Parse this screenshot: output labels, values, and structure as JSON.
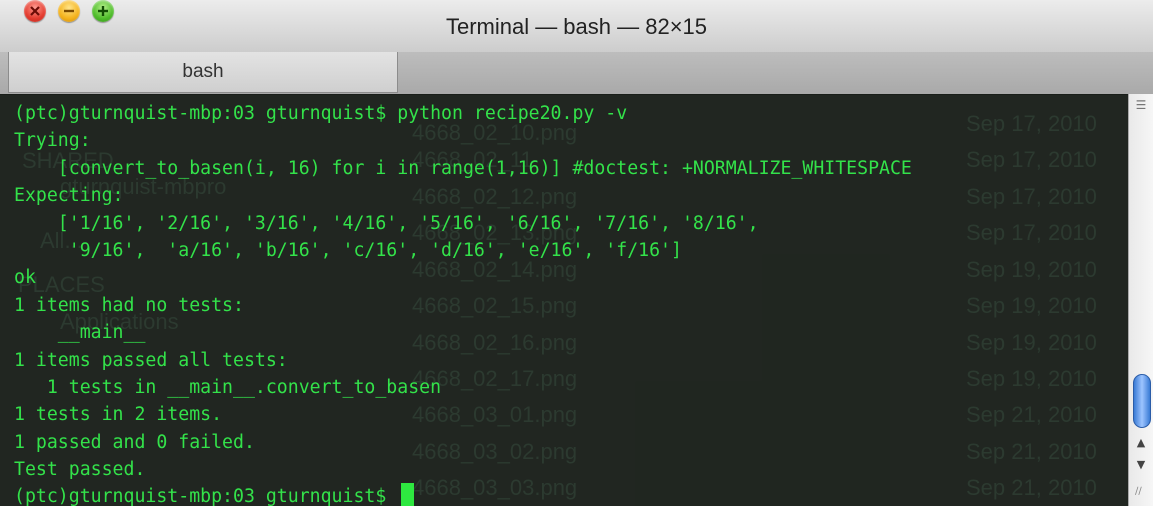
{
  "window": {
    "title": "Terminal — bash — 82×15",
    "tab_label": "bash"
  },
  "terminal": {
    "lines": [
      "(ptc)gturnquist-mbp:03 gturnquist$ python recipe20.py -v",
      "Trying:",
      "    [convert_to_basen(i, 16) for i in range(1,16)] #doctest: +NORMALIZE_WHITESPACE",
      "Expecting:",
      "    ['1/16', '2/16', '3/16', '4/16', '5/16', '6/16', '7/16', '8/16',",
      "     '9/16',  'a/16', 'b/16', 'c/16', 'd/16', 'e/16', 'f/16']",
      "ok",
      "1 items had no tests:",
      "    __main__",
      "1 items passed all tests:",
      "   1 tests in __main__.convert_to_basen",
      "1 tests in 2 items.",
      "1 passed and 0 failed.",
      "Test passed.",
      "(ptc)gturnquist-mbp:03 gturnquist$ "
    ]
  },
  "background_finder": {
    "files": [
      "4668_02_10.png",
      "4668_02_11",
      "4668_02_12.png",
      "4668_02_13.png",
      "4668_02_14.png",
      "4668_02_15.png",
      "4668_02_16.png",
      "4668_02_17.png",
      "4668_03_01.png",
      "4668_03_02.png",
      "4668_03_03.png"
    ],
    "dates": [
      "Sep 17, 2010",
      "Sep 17, 2010",
      "Sep 17, 2010",
      "Sep 17, 2010",
      "Sep 19, 2010",
      "Sep 19, 2010",
      "Sep 19, 2010",
      "Sep 19, 2010",
      "Sep 21, 2010",
      "Sep 21, 2010",
      "Sep 21, 2010"
    ],
    "sidebar": [
      "SHARED",
      "gturnquist-mbpro",
      "All...",
      "PLACES",
      "Applications"
    ]
  },
  "colors": {
    "terminal_text": "#33e24a",
    "terminal_bg": "#121812"
  }
}
